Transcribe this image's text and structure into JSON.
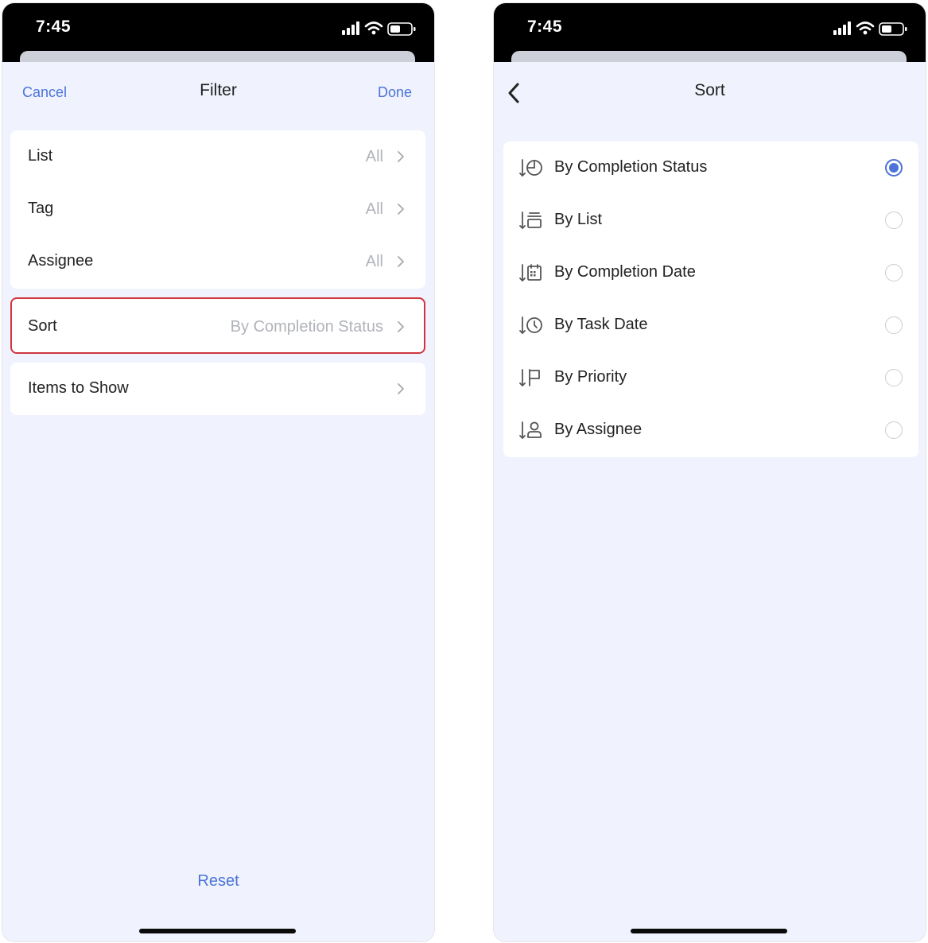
{
  "left_screen": {
    "status_time": "7:45",
    "nav": {
      "cancel": "Cancel",
      "title": "Filter",
      "done": "Done"
    },
    "filters": [
      {
        "label": "List",
        "value": "All"
      },
      {
        "label": "Tag",
        "value": "All"
      },
      {
        "label": "Assignee",
        "value": "All"
      }
    ],
    "sort": {
      "label": "Sort",
      "value": "By Completion Status"
    },
    "items_to_show": {
      "label": "Items to Show"
    },
    "reset": "Reset"
  },
  "right_screen": {
    "status_time": "7:45",
    "title": "Sort",
    "options": [
      {
        "label": "By Completion Status",
        "icon": "completion-status-sort-icon",
        "selected": true
      },
      {
        "label": "By List",
        "icon": "list-sort-icon",
        "selected": false
      },
      {
        "label": "By Completion Date",
        "icon": "completion-date-sort-icon",
        "selected": false
      },
      {
        "label": "By Task Date",
        "icon": "task-date-sort-icon",
        "selected": false
      },
      {
        "label": "By Priority",
        "icon": "priority-sort-icon",
        "selected": false
      },
      {
        "label": "By Assignee",
        "icon": "assignee-sort-icon",
        "selected": false
      }
    ]
  },
  "colors": {
    "accent": "#4b73d9",
    "highlight_border": "#d0353f",
    "background": "#f0f3fd"
  }
}
